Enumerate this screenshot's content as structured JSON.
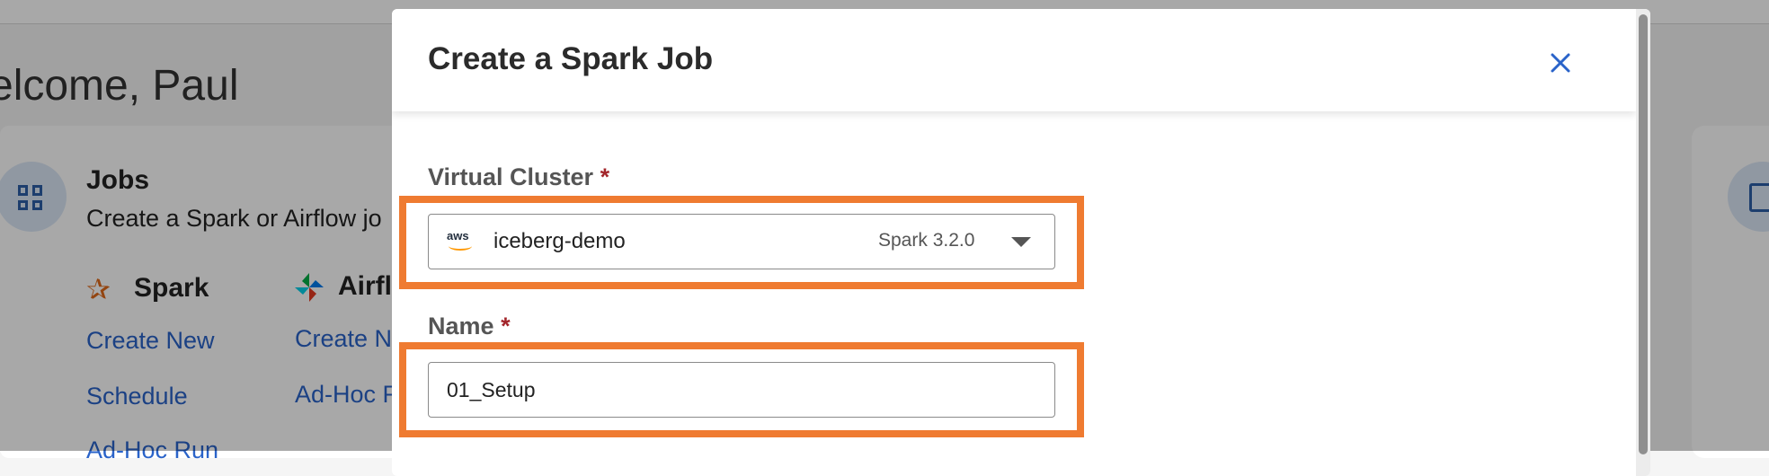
{
  "background": {
    "welcome": "elcome, Paul",
    "jobs_title": "Jobs",
    "jobs_desc": "Create a Spark or Airflow jo",
    "spark_label": "Spark",
    "airflow_label": "Airfl",
    "spark_links": [
      "Create New",
      "Schedule",
      "Ad-Hoc Run"
    ],
    "airflow_links": [
      "Create N",
      "Ad-Hoc R"
    ]
  },
  "modal": {
    "title": "Create a Spark Job",
    "close_icon": "close-icon",
    "virtual_cluster": {
      "label": "Virtual Cluster",
      "required_mark": "*",
      "provider_icon": "aws-icon",
      "provider_text": "aws",
      "value": "iceberg-demo",
      "spark_version": "Spark 3.2.0"
    },
    "name": {
      "label": "Name",
      "required_mark": "*",
      "value": "01_Setup"
    }
  },
  "colors": {
    "highlight": "#ef7b31",
    "link": "#2a63c9",
    "required": "#a3262b"
  }
}
